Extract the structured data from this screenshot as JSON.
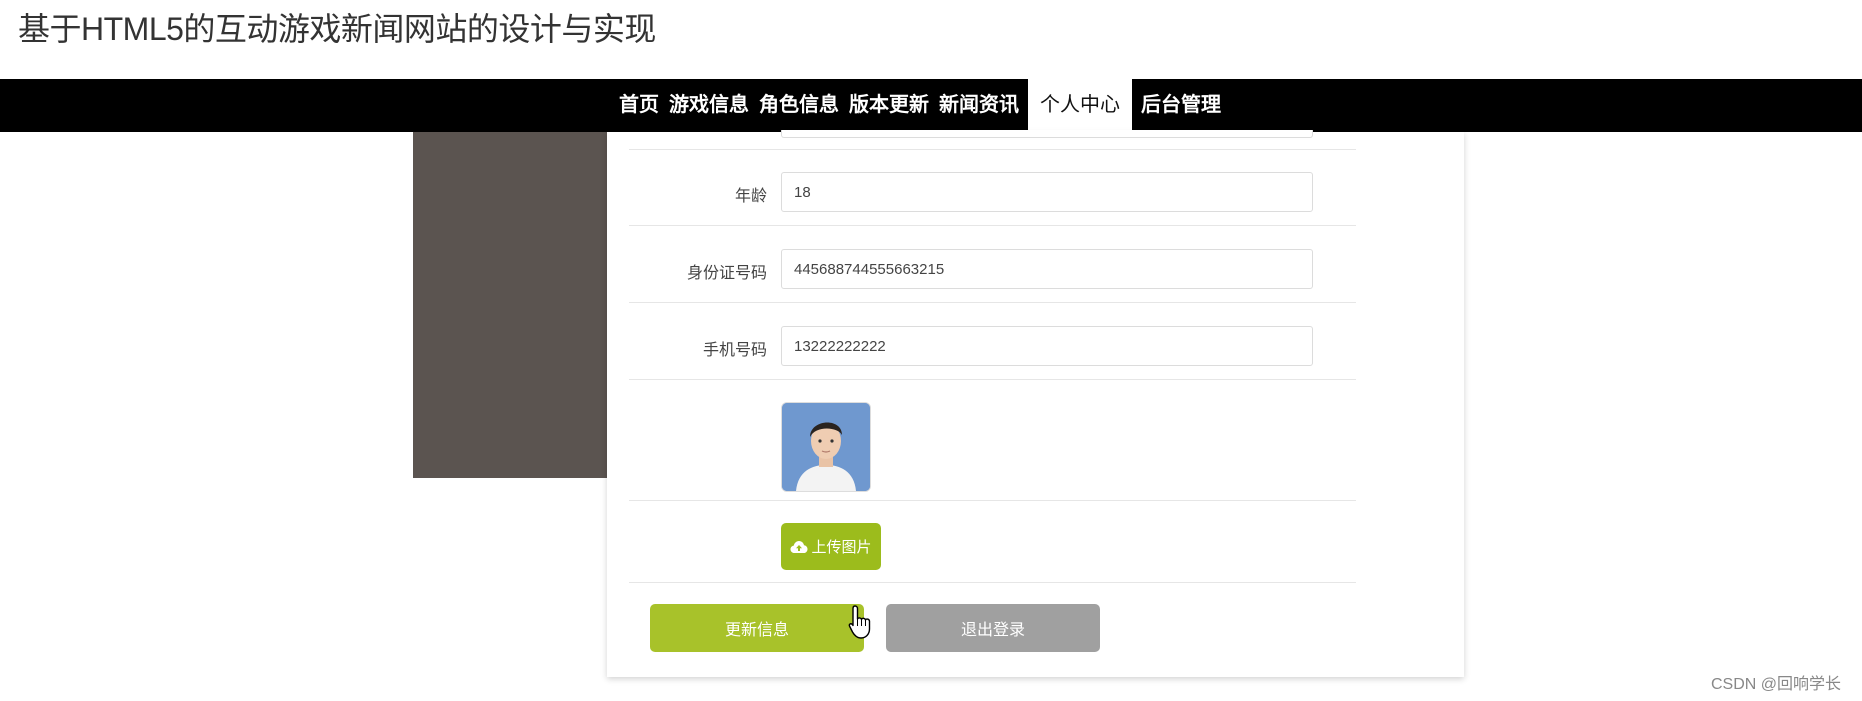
{
  "page": {
    "title": "基于HTML5的互动游戏新闻网站的设计与实现"
  },
  "nav": {
    "items": [
      {
        "label": "首页",
        "active": false
      },
      {
        "label": "游戏信息",
        "active": false
      },
      {
        "label": "角色信息",
        "active": false
      },
      {
        "label": "版本更新",
        "active": false
      },
      {
        "label": "新闻资讯",
        "active": false
      },
      {
        "label": "个人中心",
        "active": true
      },
      {
        "label": "后台管理",
        "active": false
      }
    ]
  },
  "form": {
    "age_label": "年龄",
    "age_value": "18",
    "id_label": "身份证号码",
    "id_value": "445688744555663215",
    "phone_label": "手机号码",
    "phone_value": "13222222222",
    "upload_label": "上传图片",
    "update_label": "更新信息",
    "logout_label": "退出登录"
  },
  "watermark": "CSDN @回响学长",
  "colors": {
    "nav_bg": "#000000",
    "accent_green": "#a8c22a",
    "logout_gray": "#a0a0a0",
    "side_panel": "#5b5450"
  }
}
